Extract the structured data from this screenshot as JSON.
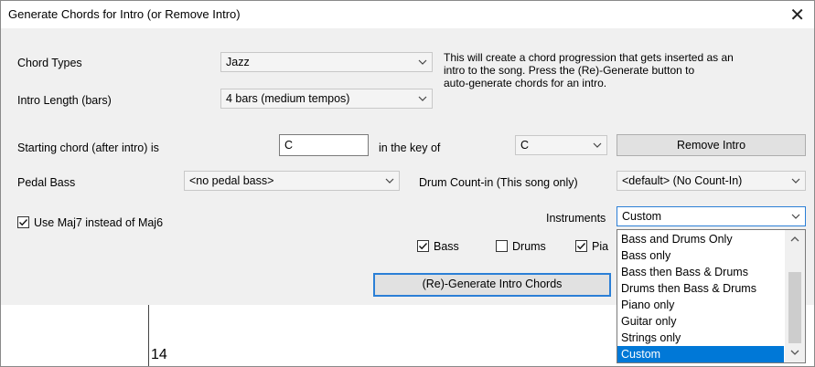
{
  "dialog": {
    "title": "Generate Chords for Intro (or Remove Intro)",
    "close_glyph": "✕"
  },
  "chord_types": {
    "label": "Chord Types",
    "value": "Jazz"
  },
  "intro_length": {
    "label": "Intro Length (bars)",
    "value": "4 bars (medium tempos)"
  },
  "description": [
    "This will create a chord progression that gets inserted as an",
    "intro to the song. Press the (Re)-Generate button to",
    "auto-generate chords for an intro."
  ],
  "starting_chord": {
    "label": "Starting chord (after intro) is",
    "value": "C",
    "key_label": "in the key of",
    "key_value": "C"
  },
  "remove_intro_button": "Remove Intro",
  "pedal_bass": {
    "label": "Pedal Bass",
    "value": "<no pedal bass>"
  },
  "drum_countin": {
    "label": "Drum Count-in (This song only)",
    "value": "<default> (No Count-In)"
  },
  "use_maj7": {
    "label": "Use Maj7 instead of Maj6",
    "checked": true
  },
  "instruments": {
    "label": "Instruments",
    "value": "Custom",
    "options": [
      "Bass and Drums Only",
      "Bass only",
      "Bass then Bass & Drums",
      "Drums then Bass & Drums",
      "Piano only",
      "Guitar only",
      "Strings only",
      "Custom"
    ],
    "selected_index": 7
  },
  "instrument_checks": [
    {
      "label": "Bass",
      "checked": true
    },
    {
      "label": "Drums",
      "checked": false
    },
    {
      "label": "Pia",
      "checked": true
    }
  ],
  "generate_button": "(Re)-Generate Intro Chords",
  "sheet": {
    "bar_number": "14"
  },
  "colors": {
    "accent": "#0078d7",
    "focus_border": "#2b7fd6",
    "dialog_bg": "#f0f0f0"
  }
}
